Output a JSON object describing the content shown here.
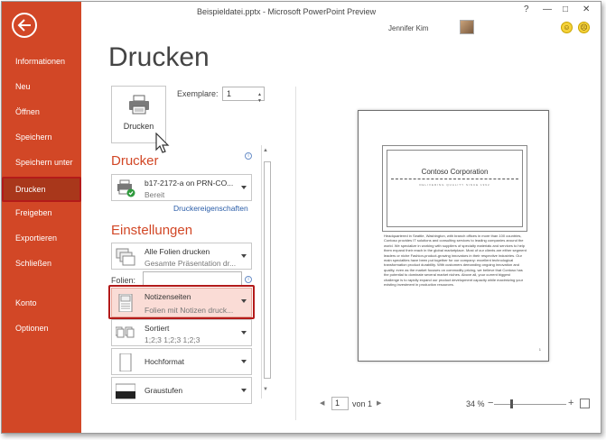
{
  "window": {
    "title": "Beispieldatei.pptx - Microsoft PowerPoint Preview",
    "help": "?",
    "minimize": "—",
    "restore": "□",
    "close": "✕",
    "user_name": "Jennifer Kim"
  },
  "nav": {
    "back_icon": "arrow-left-icon",
    "items": [
      {
        "label": "Informationen"
      },
      {
        "label": "Neu"
      },
      {
        "label": "Öffnen"
      },
      {
        "label": "Speichern"
      },
      {
        "label": "Speichern unter"
      },
      {
        "label": "Drucken"
      },
      {
        "label": "Freigeben"
      },
      {
        "label": "Exportieren"
      },
      {
        "label": "Schließen"
      },
      {
        "label": "Konto"
      },
      {
        "label": "Optionen"
      }
    ],
    "active": "Drucken"
  },
  "main": {
    "heading": "Drucken",
    "print_button": "Drucken",
    "copies_label": "Exemplare:",
    "copies_value": "1",
    "printer_section": "Drucker",
    "printer": {
      "name": "b17-2172-a on PRN-CO...",
      "status": "Bereit"
    },
    "printer_properties": "Druckereigenschaften",
    "settings_section": "Einstellungen",
    "slides_label": "Folien:",
    "settings": [
      {
        "title": "Alle Folien drucken",
        "subtitle": "Gesamte Präsentation dr..."
      },
      {
        "title": "Notizenseiten",
        "subtitle": "Folien mit Notizen druck..."
      },
      {
        "title": "Sortiert",
        "subtitle": "1;2;3   1;2;3   1;2;3"
      },
      {
        "title": "Hochformat",
        "subtitle": ""
      },
      {
        "title": "Graustufen",
        "subtitle": ""
      }
    ]
  },
  "preview": {
    "slide_title": "Contoso Corporation",
    "slide_subtitle": "DELIVERING QUALITY SINCE 1992",
    "notes": "Headquartered in Seattle, Washington, with branch offices in more than 100 countries, Contoso provides IT solutions and consulting services to leading companies around the world. We specialize in working with suppliers of specialty materials and services to help them expand their reach in the global marketplace. Most of our clients are either segment leaders or niche Fashion-product-growing innovators in their respective industries. Our main specialties have been put together for our company: excellent technological transformation product durability. With customers demanding ongoing innovation and quality, even as the market focuses on commodity pricing, we believe that Contoso has the potential to dominate several market niches. Above all, your current biggest challenge is to rapidly expand our product development capacity while maximizing your existing investment in production resources.",
    "page_number": "1"
  },
  "pager": {
    "prev": "◀",
    "next": "▶",
    "current_page": "1",
    "of_label": "von 1"
  },
  "zoom": {
    "label": "34 %",
    "minus": "−",
    "plus": "+",
    "level_percent": 34
  }
}
